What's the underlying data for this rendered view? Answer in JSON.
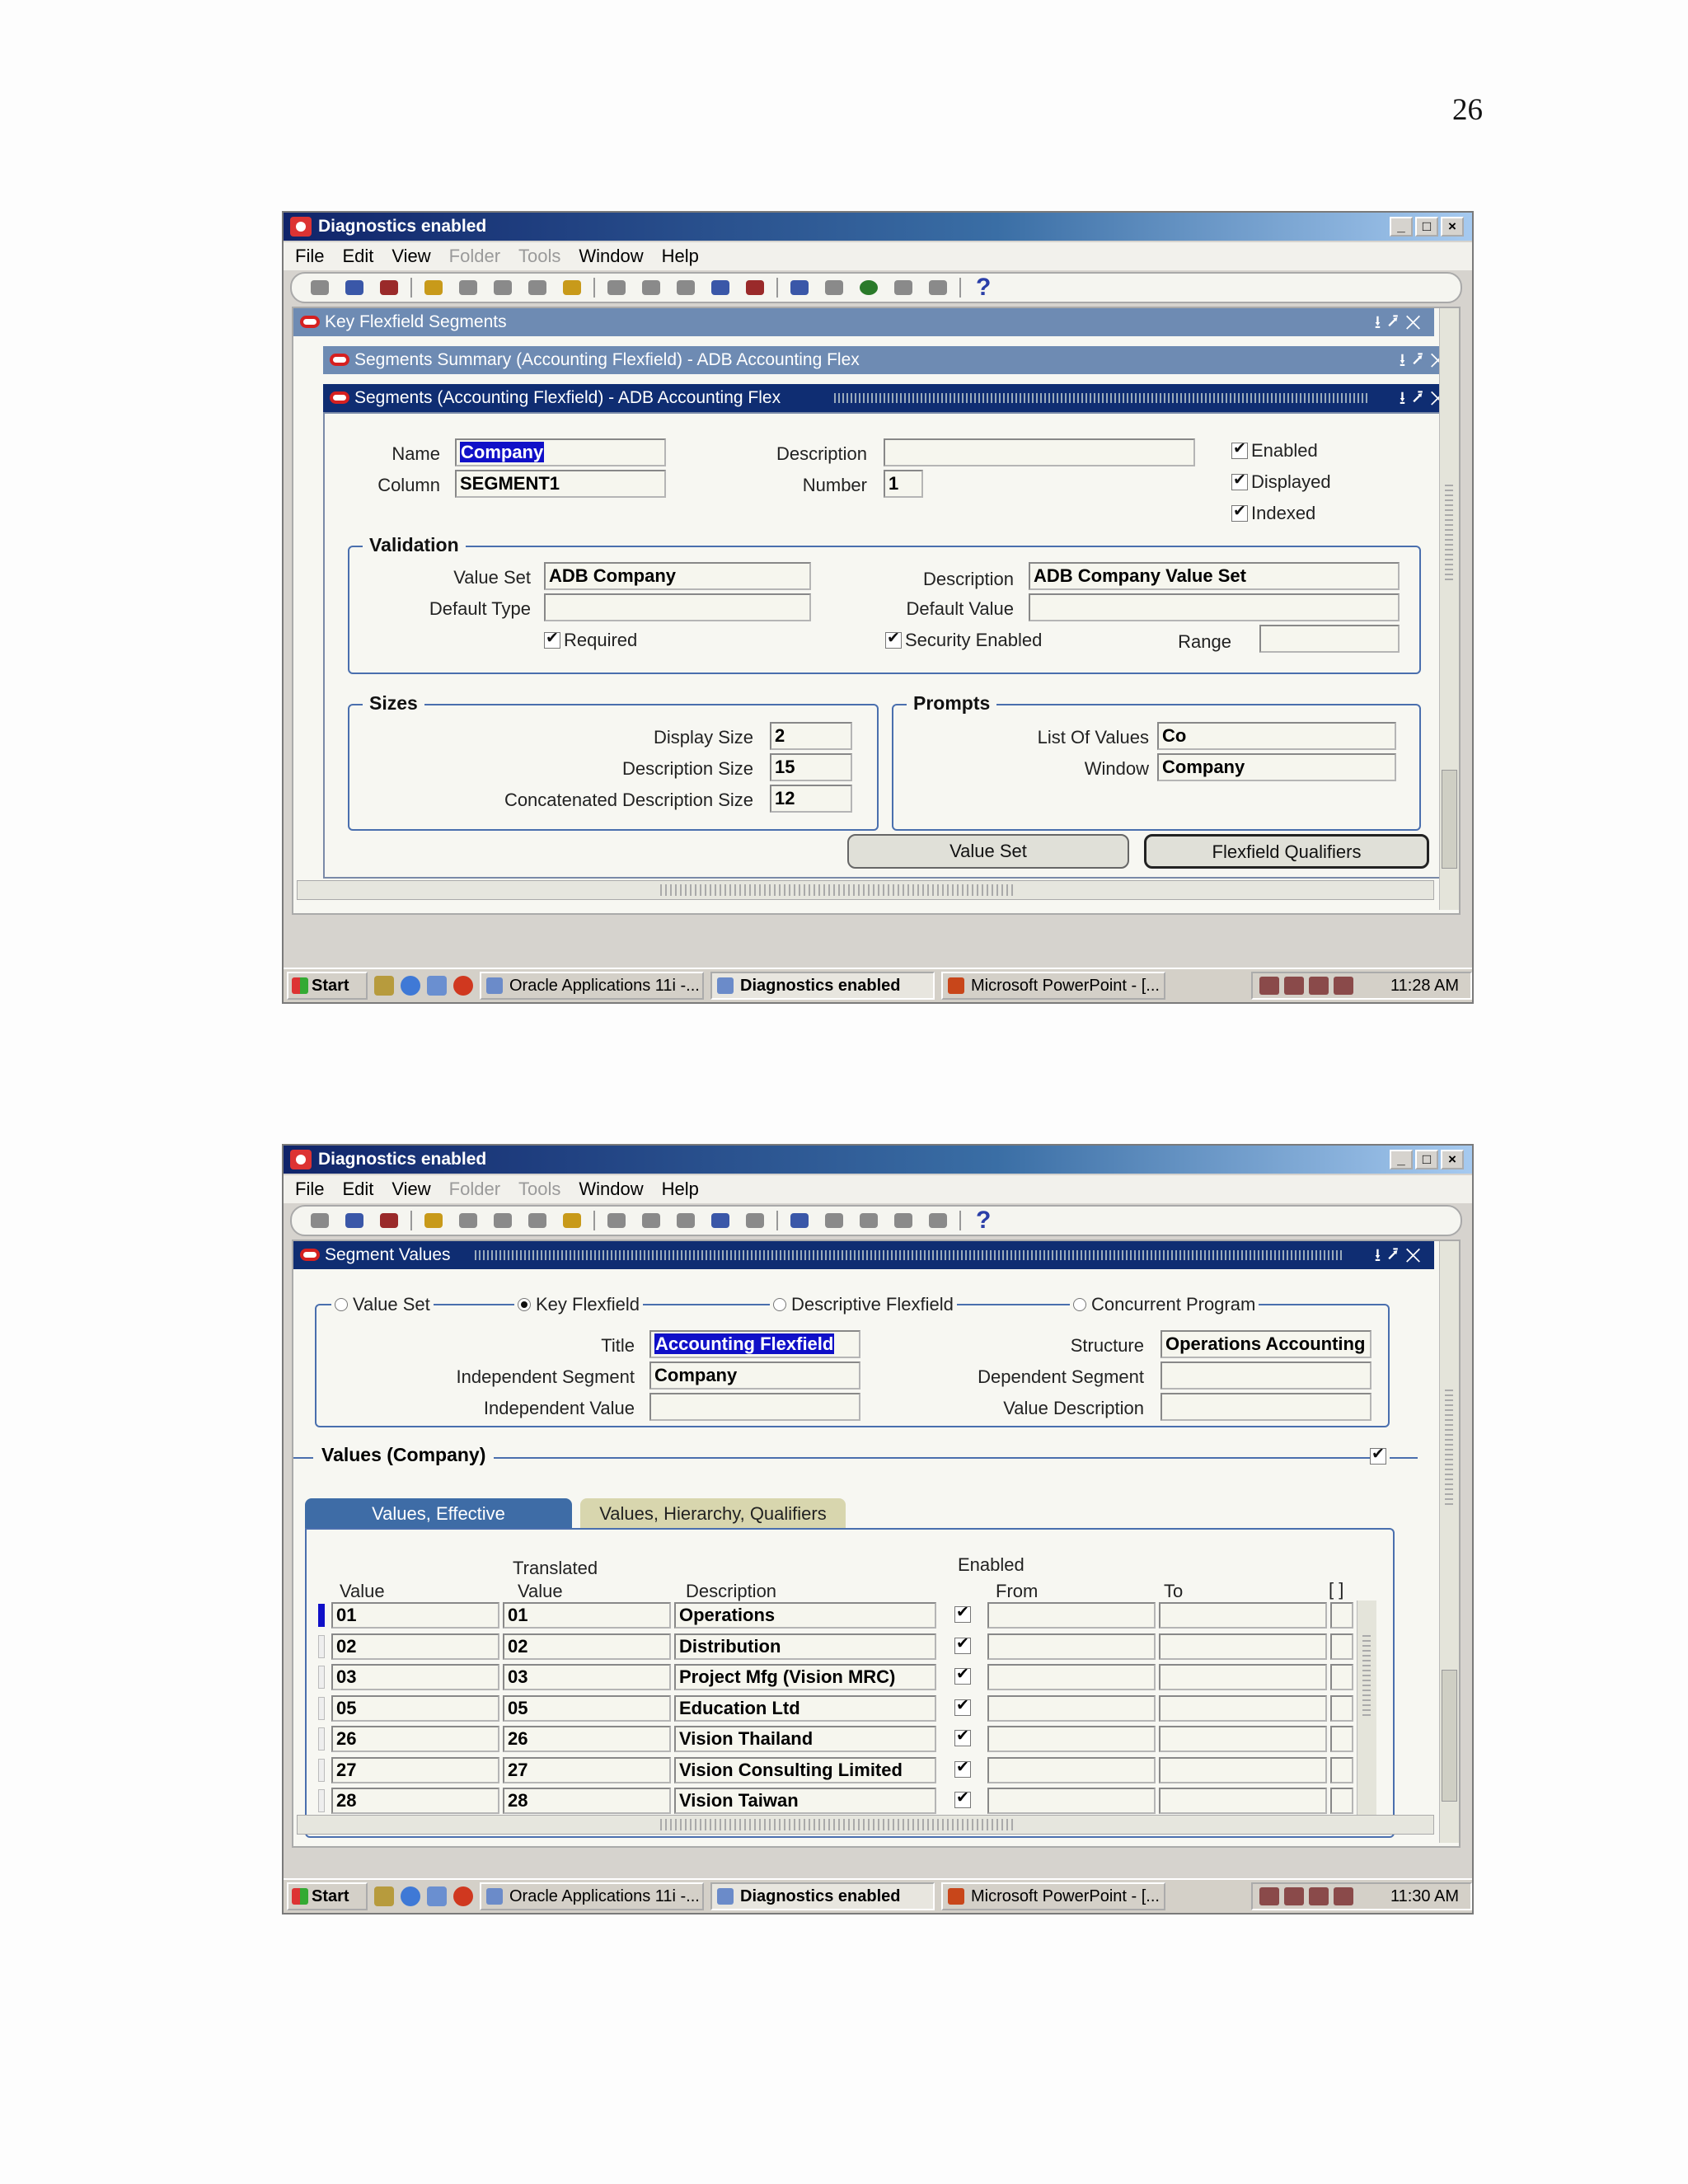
{
  "page_number": "26",
  "screenshots": [
    {
      "window_title": "Diagnostics enabled",
      "menu": [
        "File",
        "Edit",
        "View",
        "Folder",
        "Tools",
        "Window",
        "Help"
      ],
      "panel_kff": "Key Flexfield Segments",
      "panel_summary": "Segments Summary (Accounting Flexfield) - ADB Accounting Flex",
      "panel_segments": "Segments (Accounting Flexfield) - ADB Accounting Flex",
      "name_label": "Name",
      "name_value": "Company",
      "column_label": "Column",
      "column_value": "SEGMENT1",
      "description_label": "Description",
      "description_value": "",
      "number_label": "Number",
      "number_value": "1",
      "enabled": "Enabled",
      "displayed": "Displayed",
      "indexed": "Indexed",
      "validation": {
        "title": "Validation",
        "value_set_label": "Value Set",
        "value_set": "ADB Company",
        "default_type_label": "Default Type",
        "default_type": "",
        "required": "Required",
        "description_label": "Description",
        "description": "ADB Company Value Set",
        "default_value_label": "Default Value",
        "default_value": "",
        "security": "Security Enabled",
        "range_label": "Range",
        "range": ""
      },
      "sizes": {
        "title": "Sizes",
        "display_label": "Display Size",
        "display": "2",
        "desc_label": "Description Size",
        "desc": "15",
        "concat_label": "Concatenated Description Size",
        "concat": "12"
      },
      "prompts": {
        "title": "Prompts",
        "lov_label": "List Of Values",
        "lov": "Co",
        "window_label": "Window",
        "window": "Company"
      },
      "btn_value_set": "Value Set",
      "btn_qualifiers": "Flexfield Qualifiers",
      "taskbar": {
        "start": "Start",
        "task1": "Oracle Applications 11i -...",
        "task2": "Diagnostics enabled",
        "task3": "Microsoft PowerPoint - [...",
        "time": "11:28 AM"
      }
    },
    {
      "window_title": "Diagnostics enabled",
      "menu": [
        "File",
        "Edit",
        "View",
        "Folder",
        "Tools",
        "Window",
        "Help"
      ],
      "panel_title": "Segment Values",
      "radios": [
        "Value Set",
        "Key Flexfield",
        "Descriptive Flexfield",
        "Concurrent Program"
      ],
      "title_label": "Title",
      "title_value": "Accounting Flexfield",
      "structure_label": "Structure",
      "structure_value": "Operations Accounting",
      "indep_seg_label": "Independent Segment",
      "indep_seg_value": "Company",
      "dep_seg_label": "Dependent Segment",
      "dep_seg_value": "",
      "indep_val_label": "Independent Value",
      "indep_val_value": "",
      "val_desc_label": "Value Description",
      "val_desc_value": "",
      "values_title": "Values (Company)",
      "tabs": [
        "Values, Effective",
        "Values, Hierarchy, Qualifiers"
      ],
      "col_value": "Value",
      "col_translated": "Translated",
      "col_translated2": "Value",
      "col_description": "Description",
      "col_enabled": "Enabled",
      "col_from": "From",
      "col_to": "To",
      "col_flex": "[ ]",
      "rows": [
        {
          "value": "01",
          "translated": "01",
          "description": "Operations"
        },
        {
          "value": "02",
          "translated": "02",
          "description": "Distribution"
        },
        {
          "value": "03",
          "translated": "03",
          "description": "Project Mfg (Vision MRC)"
        },
        {
          "value": "05",
          "translated": "05",
          "description": "Education Ltd"
        },
        {
          "value": "26",
          "translated": "26",
          "description": "Vision Thailand"
        },
        {
          "value": "27",
          "translated": "27",
          "description": "Vision Consulting Limited"
        },
        {
          "value": "28",
          "translated": "28",
          "description": "Vision Taiwan"
        }
      ],
      "taskbar": {
        "start": "Start",
        "task1": "Oracle Applications 11i -...",
        "task2": "Diagnostics enabled",
        "task3": "Microsoft PowerPoint - [...",
        "time": "11:30 AM"
      }
    }
  ]
}
